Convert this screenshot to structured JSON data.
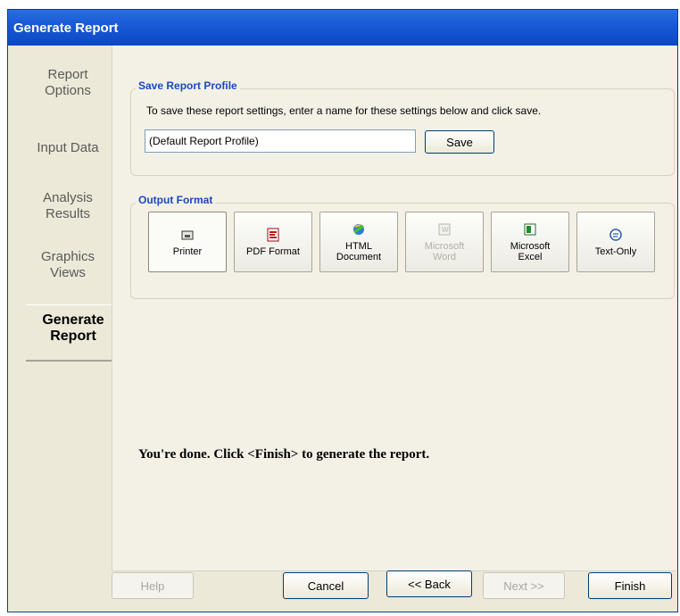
{
  "window": {
    "title": "Generate Report"
  },
  "sidebar": {
    "items": [
      {
        "label": "Report Options"
      },
      {
        "label": "Input Data"
      },
      {
        "label": "Analysis Results"
      },
      {
        "label": "Graphics Views"
      },
      {
        "label": "Generate Report"
      }
    ]
  },
  "save_profile": {
    "title": "Save Report Profile",
    "instruction": "To save these report settings, enter a name for these settings below and click save.",
    "input_value": "(Default Report Profile)",
    "save_label": "Save"
  },
  "output_format": {
    "title": "Output Format",
    "options": [
      {
        "label": "Printer",
        "icon": "printer-icon",
        "selected": true
      },
      {
        "label": "PDF Format",
        "icon": "pdf-icon"
      },
      {
        "label": "HTML Document",
        "icon": "html-icon"
      },
      {
        "label": "Microsoft Word",
        "icon": "word-icon",
        "disabled": true
      },
      {
        "label": "Microsoft Excel",
        "icon": "excel-icon"
      },
      {
        "label": "Text-Only",
        "icon": "text-icon"
      }
    ]
  },
  "message": "You're done. Click <Finish> to generate the report.",
  "footer": {
    "help": "Help",
    "cancel": "Cancel",
    "back": "<< Back",
    "next": "Next >>",
    "finish": "Finish"
  },
  "colors": {
    "titlebar": "#0b47c4",
    "group_title": "#1b48c6",
    "panel": "#f3f1e6"
  }
}
